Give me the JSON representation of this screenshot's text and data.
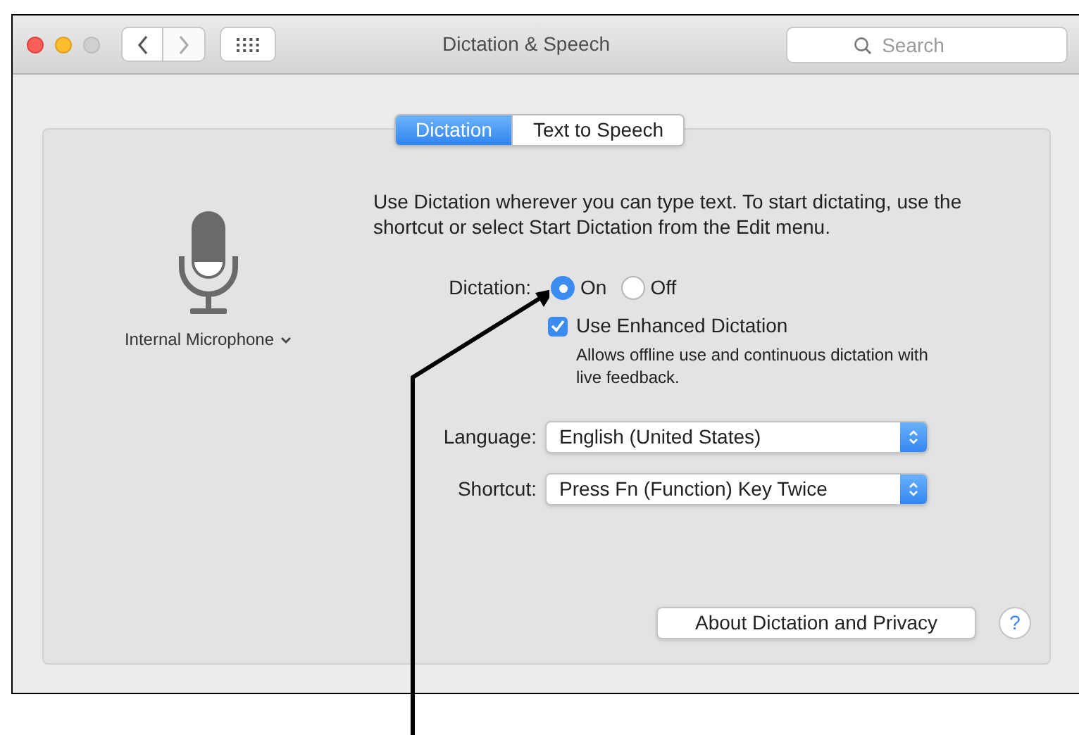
{
  "window": {
    "title": "Dictation & Speech"
  },
  "search": {
    "placeholder": "Search"
  },
  "tabs": [
    {
      "label": "Dictation",
      "selected": true
    },
    {
      "label": "Text to Speech",
      "selected": false
    }
  ],
  "microphone": {
    "label": "Internal Microphone"
  },
  "description": "Use Dictation wherever you can type text. To start dictating, use the shortcut or select Start Dictation from the Edit menu.",
  "dictation": {
    "label": "Dictation:",
    "options": [
      {
        "label": "On",
        "selected": true
      },
      {
        "label": "Off",
        "selected": false
      }
    ]
  },
  "enhanced": {
    "label": "Use Enhanced Dictation",
    "checked": true,
    "note": "Allows offline use and continuous dictation with live feedback."
  },
  "popups": [
    {
      "label": "Language:",
      "value": "English (United States)"
    },
    {
      "label": "Shortcut:",
      "value": "Press Fn (Function) Key Twice"
    }
  ],
  "about_button": "About Dictation and Privacy",
  "help_button": "?"
}
